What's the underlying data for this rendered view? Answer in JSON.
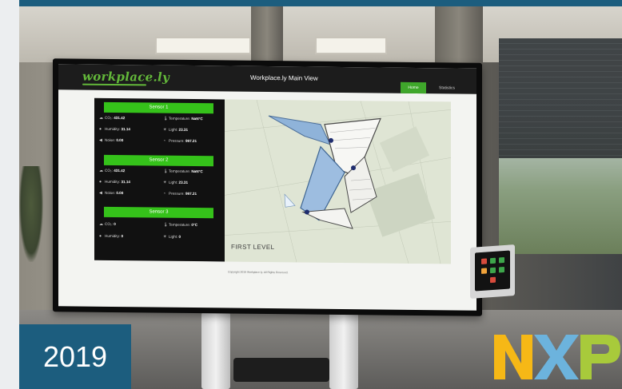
{
  "app": {
    "logo_text": "workplace.ly",
    "title": "Workplace.ly Main View",
    "nav": {
      "home": "Home",
      "statistics": "Statistics"
    }
  },
  "sensors": [
    {
      "title": "Sensor 1",
      "metrics": [
        {
          "icon": "cloud-icon",
          "label": "CO₂:",
          "value": "431.42"
        },
        {
          "icon": "thermometer-icon",
          "label": "Temperature:",
          "value": "NaN°C"
        },
        {
          "icon": "droplet-icon",
          "label": "Humidity:",
          "value": "31.14"
        },
        {
          "icon": "sun-icon",
          "label": "Light:",
          "value": "23.31"
        },
        {
          "icon": "speaker-icon",
          "label": "Noise:",
          "value": "0.00"
        },
        {
          "icon": "gauge-icon",
          "label": "Pressure:",
          "value": "997.21"
        }
      ]
    },
    {
      "title": "Sensor 2",
      "metrics": [
        {
          "icon": "cloud-icon",
          "label": "CO₂:",
          "value": "431.42"
        },
        {
          "icon": "thermometer-icon",
          "label": "Temperature:",
          "value": "NaN°C"
        },
        {
          "icon": "droplet-icon",
          "label": "Humidity:",
          "value": "31.14"
        },
        {
          "icon": "sun-icon",
          "label": "Light:",
          "value": "23.31"
        },
        {
          "icon": "speaker-icon",
          "label": "Noise:",
          "value": "0.00"
        },
        {
          "icon": "gauge-icon",
          "label": "Pressure:",
          "value": "997.21"
        }
      ]
    },
    {
      "title": "Sensor 3",
      "metrics": [
        {
          "icon": "cloud-icon",
          "label": "CO₂:",
          "value": "0"
        },
        {
          "icon": "thermometer-icon",
          "label": "Temperature:",
          "value": "0°C"
        },
        {
          "icon": "droplet-icon",
          "label": "Humidity:",
          "value": "0"
        },
        {
          "icon": "sun-icon",
          "label": "Light:",
          "value": "0"
        }
      ]
    }
  ],
  "map": {
    "label": "FIRST LEVEL"
  },
  "footer": {
    "text": "Copyright 2019 Workplace.ly. All Rights Reserved."
  },
  "overlay": {
    "year": "2019",
    "brand": "NXP"
  },
  "colors": {
    "accent_green": "#35c21a",
    "header_dark": "#1c1c1c",
    "badge_blue": "#1c5d7e",
    "nxp_yellow": "#f6b816",
    "nxp_blue": "#6cb3dd",
    "nxp_green": "#a8ca3b"
  }
}
